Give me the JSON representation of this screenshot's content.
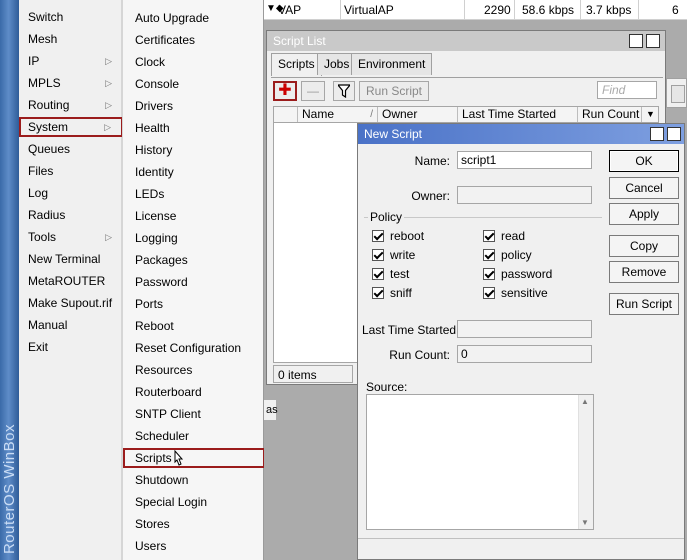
{
  "brand": "RouterOS WinBox",
  "main_menu": [
    {
      "label": "Switch",
      "has_sub": false
    },
    {
      "label": "Mesh",
      "has_sub": false
    },
    {
      "label": "IP",
      "has_sub": true
    },
    {
      "label": "MPLS",
      "has_sub": true
    },
    {
      "label": "Routing",
      "has_sub": true
    },
    {
      "label": "System",
      "has_sub": true,
      "selected": true
    },
    {
      "label": "Queues",
      "has_sub": false
    },
    {
      "label": "Files",
      "has_sub": false
    },
    {
      "label": "Log",
      "has_sub": false
    },
    {
      "label": "Radius",
      "has_sub": false
    },
    {
      "label": "Tools",
      "has_sub": true
    },
    {
      "label": "New Terminal",
      "has_sub": false
    },
    {
      "label": "MetaROUTER",
      "has_sub": false
    },
    {
      "label": "Make Supout.rif",
      "has_sub": false
    },
    {
      "label": "Manual",
      "has_sub": false
    },
    {
      "label": "Exit",
      "has_sub": false
    }
  ],
  "system_submenu": [
    "Auto Upgrade",
    "Certificates",
    "Clock",
    "Console",
    "Drivers",
    "Health",
    "History",
    "Identity",
    "LEDs",
    "License",
    "Logging",
    "Packages",
    "Password",
    "Ports",
    "Reboot",
    "Reset Configuration",
    "Resources",
    "Routerboard",
    "SNTP Client",
    "Scheduler",
    "Scripts",
    "Shutdown",
    "Special Login",
    "Stores",
    "Users"
  ],
  "submenu_selected": "Scripts",
  "background_row": {
    "name": "VAP",
    "type": "VirtualAP",
    "actual_mtu": "2290",
    "tx": "58.6 kbps",
    "rx": "3.7 kbps",
    "count": "6"
  },
  "background_fragment": "as",
  "script_list": {
    "title": "Script List",
    "tabs": [
      "Scripts",
      "Jobs",
      "Environment"
    ],
    "active_tab": "Scripts",
    "run_script_label": "Run Script",
    "find_placeholder": "Find",
    "columns": [
      "Name",
      "Owner",
      "Last Time Started",
      "Run Count"
    ],
    "status": "0 items"
  },
  "new_script": {
    "title": "New Script",
    "name_label": "Name:",
    "name_value": "script1",
    "owner_label": "Owner:",
    "owner_value": "",
    "policy_label": "Policy",
    "policies_left": [
      {
        "label": "reboot",
        "checked": true
      },
      {
        "label": "write",
        "checked": true
      },
      {
        "label": "test",
        "checked": true
      },
      {
        "label": "sniff",
        "checked": true
      }
    ],
    "policies_right": [
      {
        "label": "read",
        "checked": true
      },
      {
        "label": "policy",
        "checked": true
      },
      {
        "label": "password",
        "checked": true
      },
      {
        "label": "sensitive",
        "checked": true
      }
    ],
    "last_started_label": "Last Time Started:",
    "last_started_value": "",
    "run_count_label": "Run Count:",
    "run_count_value": "0",
    "source_label": "Source:",
    "buttons": {
      "ok": "OK",
      "cancel": "Cancel",
      "apply": "Apply",
      "copy": "Copy",
      "remove": "Remove",
      "run_script": "Run Script"
    }
  },
  "colors": {
    "highlight_border": "#9b1c1c",
    "dialog_title": "#4a72c7"
  }
}
